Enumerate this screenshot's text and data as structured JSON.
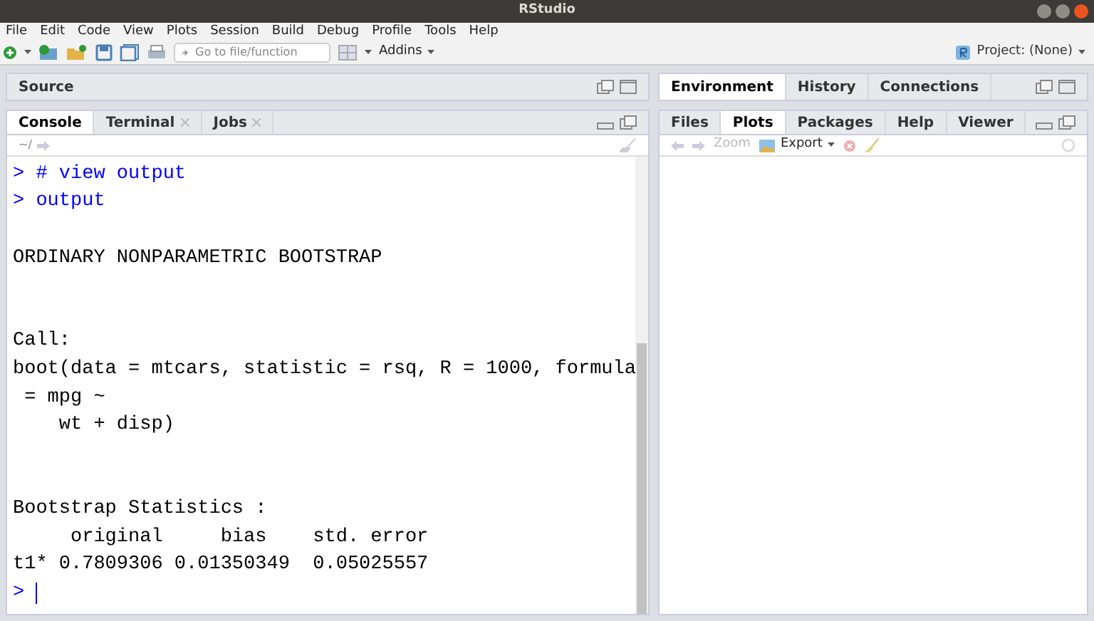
{
  "window": {
    "title": "RStudio"
  },
  "menu": [
    "File",
    "Edit",
    "Code",
    "View",
    "Plots",
    "Session",
    "Build",
    "Debug",
    "Profile",
    "Tools",
    "Help"
  ],
  "toolbar": {
    "goto_placeholder": "Go to file/function",
    "addins": "Addins",
    "project": "Project: (None)"
  },
  "source_pane": {
    "title": "Source"
  },
  "console_tabs": [
    {
      "label": "Console",
      "selected": true,
      "closable": false
    },
    {
      "label": "Terminal",
      "selected": false,
      "closable": true
    },
    {
      "label": "Jobs",
      "selected": false,
      "closable": true
    }
  ],
  "console_path": "~/",
  "console_lines": [
    {
      "kind": "command",
      "text": "> # view output"
    },
    {
      "kind": "command",
      "text": "> output"
    },
    {
      "kind": "blank"
    },
    {
      "kind": "output",
      "text": "ORDINARY NONPARAMETRIC BOOTSTRAP"
    },
    {
      "kind": "blank"
    },
    {
      "kind": "blank"
    },
    {
      "kind": "output",
      "text": "Call:"
    },
    {
      "kind": "output",
      "text": "boot(data = mtcars, statistic = rsq, R = 1000, formula"
    },
    {
      "kind": "output",
      "text": " = mpg ~"
    },
    {
      "kind": "output",
      "text": "    wt + disp)"
    },
    {
      "kind": "blank"
    },
    {
      "kind": "blank"
    },
    {
      "kind": "output",
      "text": "Bootstrap Statistics :"
    },
    {
      "kind": "output",
      "text": "     original     bias    std. error"
    },
    {
      "kind": "output",
      "text": "t1* 0.7809306 0.01350349  0.05025557"
    },
    {
      "kind": "prompt",
      "text": ">"
    }
  ],
  "env_tabs": [
    {
      "label": "Environment",
      "selected": true
    },
    {
      "label": "History",
      "selected": false
    },
    {
      "label": "Connections",
      "selected": false
    }
  ],
  "files_tabs": [
    {
      "label": "Files",
      "selected": false
    },
    {
      "label": "Plots",
      "selected": true
    },
    {
      "label": "Packages",
      "selected": false
    },
    {
      "label": "Help",
      "selected": false
    },
    {
      "label": "Viewer",
      "selected": false
    }
  ],
  "plots_toolbar": {
    "zoom": "Zoom",
    "export": "Export"
  }
}
